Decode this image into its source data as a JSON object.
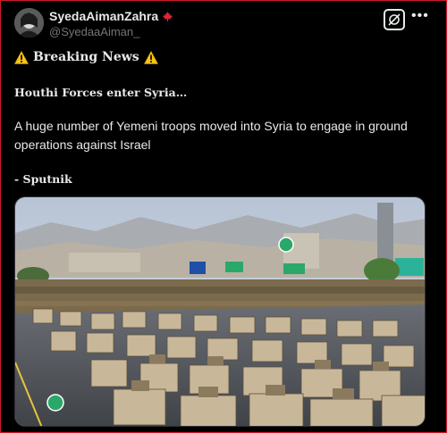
{
  "author": {
    "display_name": "SyedaAimanZahra",
    "handle": "@SyedaaAiman_",
    "flag_icon": "maple-leaf-icon"
  },
  "tweet": {
    "breaking_label": "Breaking News",
    "headline": "Houthi Forces enter Syria…",
    "body": "A huge number of Yemeni troops moved into Syria to engage in ground operations against Israel",
    "source": "- Sputnik"
  },
  "colors": {
    "background": "#000000",
    "border": "#d11a2a",
    "text": "#e7e9ea",
    "muted": "#71767b",
    "warning": "#f5c518"
  }
}
